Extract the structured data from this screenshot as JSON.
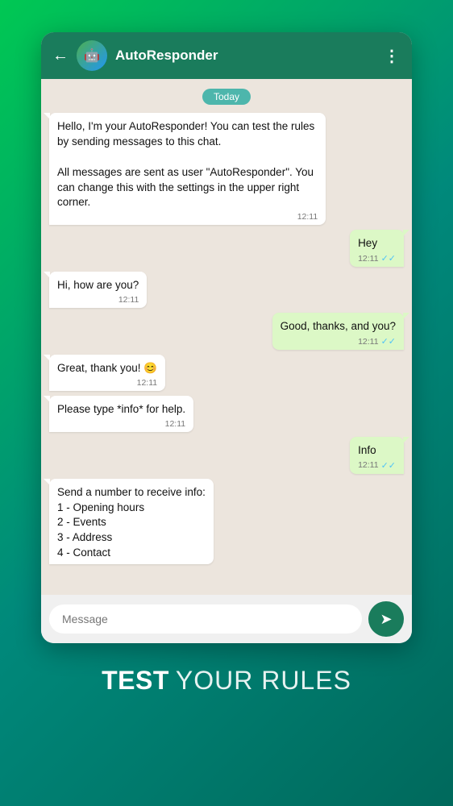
{
  "header": {
    "title": "AutoResponder",
    "back_icon": "←",
    "menu_icon": "⋮"
  },
  "chat": {
    "date_badge": "Today",
    "messages": [
      {
        "type": "received",
        "text": "Hello, I'm your AutoResponder! You can test the rules by sending messages to this chat.\n\nAll messages are sent as user \"AutoResponder\". You can change this with the settings in the upper right corner.",
        "time": "12:11",
        "tick": false
      },
      {
        "type": "sent",
        "text": "Hey",
        "time": "12:11",
        "tick": true
      },
      {
        "type": "received",
        "text": "Hi, how are you?",
        "time": "12:11",
        "tick": false
      },
      {
        "type": "sent",
        "text": "Good, thanks, and you?",
        "time": "12:11",
        "tick": true
      },
      {
        "type": "received",
        "text": "Great, thank you! 😊",
        "time": "12:11",
        "tick": false
      },
      {
        "type": "received",
        "text": "Please type *info* for help.",
        "time": "12:11",
        "tick": false
      },
      {
        "type": "sent",
        "text": "Info",
        "time": "12:11",
        "tick": true
      },
      {
        "type": "received",
        "text": "Send a number to receive info:\n1 - Opening hours\n2 - Events\n3 - Address\n4 - Contact",
        "time": "",
        "tick": false
      }
    ],
    "input_placeholder": "Message"
  },
  "bottom": {
    "bold_text": "TEST",
    "regular_text": "YOUR RULES"
  }
}
